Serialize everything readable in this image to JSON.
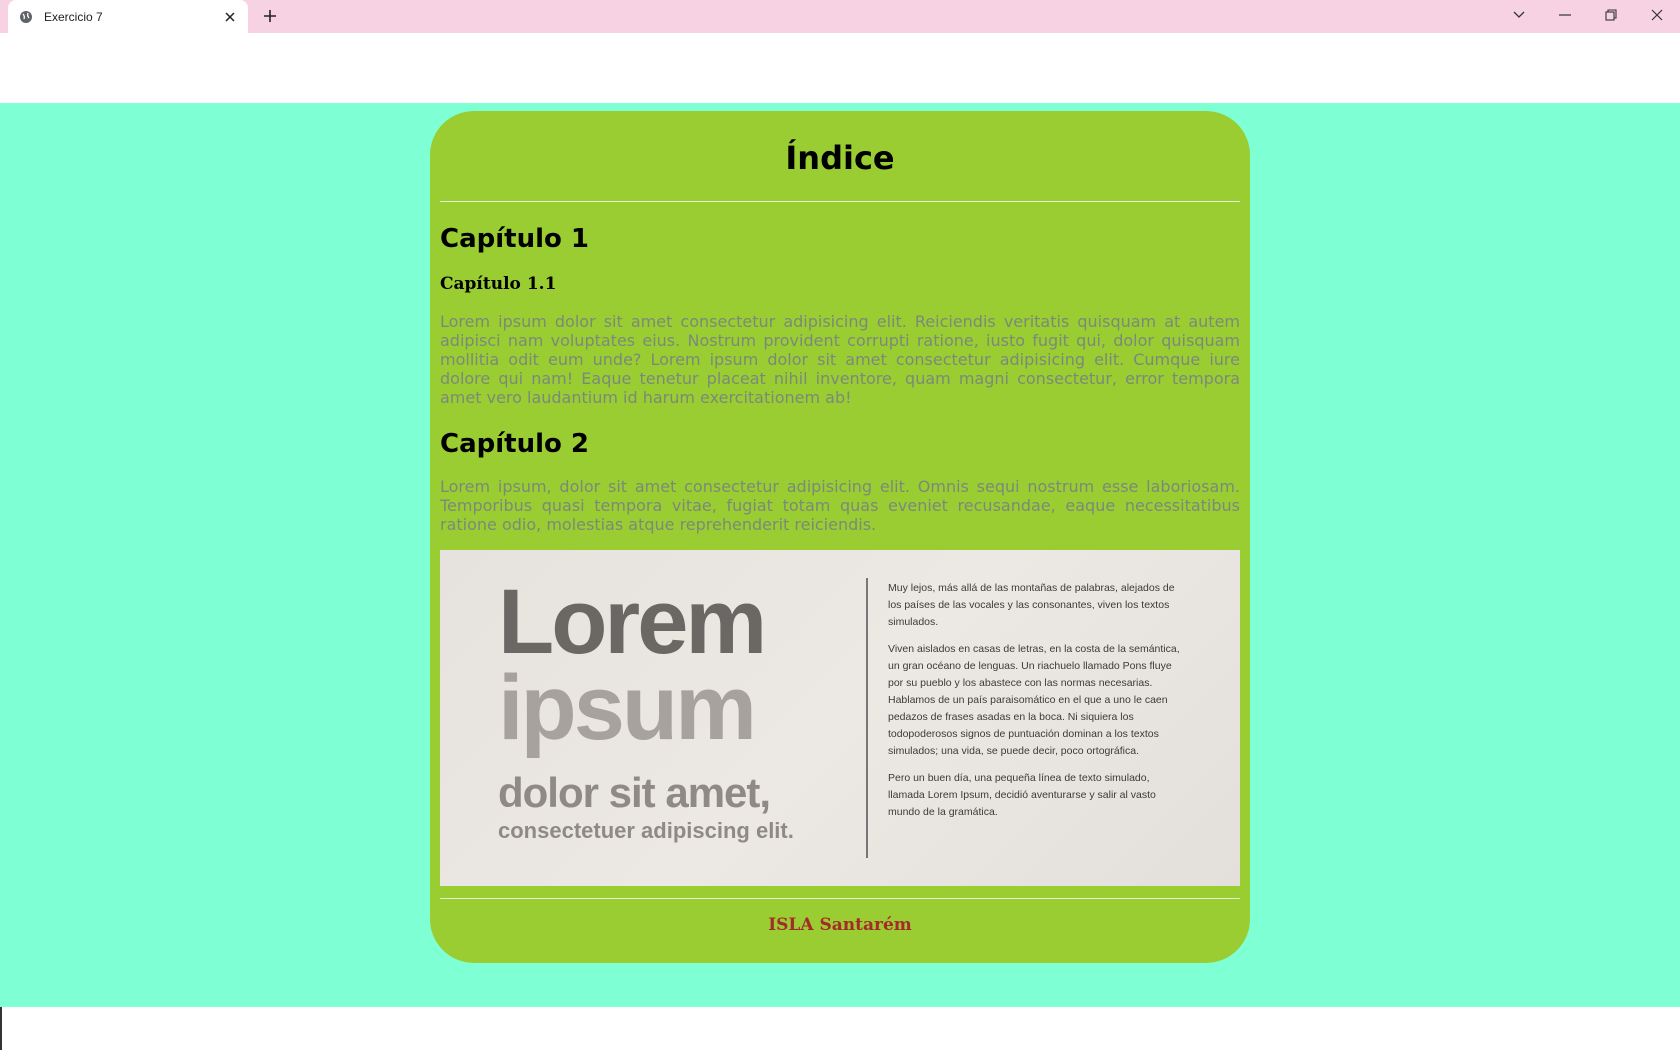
{
  "browser": {
    "tab_title": "Exercicio 7"
  },
  "page": {
    "heading": "Índice",
    "chapter1": {
      "title": "Capítulo 1",
      "subtitle": "Capítulo 1.1",
      "text": "Lorem ipsum dolor sit amet consectetur adipisicing elit. Reiciendis veritatis quisquam at autem adipisci nam voluptates eius. Nostrum provident corrupti ratione, iusto fugit qui, dolor quisquam mollitia odit eum unde? Lorem ipsum dolor sit amet consectetur adipisicing elit. Cumque iure dolore qui nam! Eaque tenetur placeat nihil inventore, quam magni consectetur, error tempora amet vero laudantium id harum exercitationem ab!"
    },
    "chapter2": {
      "title": "Capítulo 2",
      "text": "Lorem ipsum, dolor sit amet consectetur adipisicing elit. Omnis sequi nostrum esse laboriosam. Temporibus quasi tempora vitae, fugiat totam quas eveniet recusandae, eaque necessitatibus ratione odio, molestias atque reprehenderit reiciendis."
    },
    "image": {
      "line1": "Lorem",
      "line2": "ipsum",
      "line3": "dolor sit amet,",
      "line4": "consectetuer adipiscing elit.",
      "para1": "Muy lejos, más allá de las montañas de palabras, alejados de los países de las vocales y las consonantes, viven los textos simulados.",
      "para2": "Viven aislados en casas de letras, en la costa de la semántica, un gran océano de lenguas. Un riachuelo llamado Pons fluye por su pueblo y los abastece con las normas necesarias. Hablamos de un país paraisomático en el que a uno le caen pedazos de frases asadas en la boca. Ni siquiera los todopoderosos signos de puntuación dominan a los textos simulados; una vida, se puede decir, poco ortográfica.",
      "para3": "Pero un buen día, una pequeña línea de texto simulado, llamada Lorem Ipsum, decidió aventurarse y salir al vasto mundo de la gramática."
    },
    "footer": "ISLA Santarém"
  },
  "colors": {
    "background": "#7fffd4",
    "card": "#9acd32",
    "footer_text": "#a52a2a",
    "tabstrip": "#f6d2e2"
  }
}
